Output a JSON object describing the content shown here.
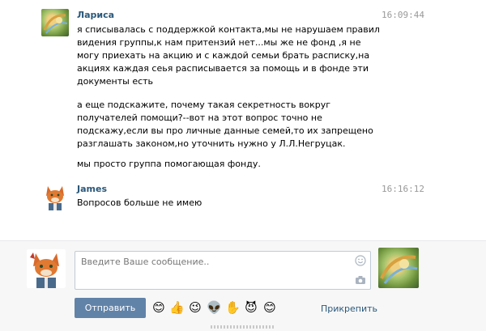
{
  "messages": [
    {
      "author": "Лариса",
      "time": "16:09:44",
      "paragraphs": [
        "я списывалась с поддержкой контакта,мы не нарушаем правил видения группы,к нам притензий нет...мы же не фонд ,я не могу приехать на акцию и с каждой семьи брать расписку,на акциях каждая сеья расписывается за помощь и в фонде эти документы есть",
        "а еще подскажите, почему такая секретность вокруг получателей помощи?--вот на этот вопрос точно не подскажу,если вы про личные данные семей,то их запрещено разглашать законом,но уточнить нужно у Л.Л.Негруцак.",
        "мы просто группа помогающая фонду."
      ]
    },
    {
      "author": "James",
      "time": "16:16:12",
      "paragraphs": [
        "Вопросов больше не имею"
      ]
    }
  ],
  "composer": {
    "placeholder": "Введите Ваше сообщение..",
    "send_label": "Отправить",
    "attach_label": "Прикрепить",
    "emojis": [
      "😊",
      "👍",
      "😉",
      "👽",
      "✋",
      "😈",
      "😊"
    ],
    "icons": [
      "smile-icon",
      "camera-icon"
    ]
  },
  "colors": {
    "author": "#2b587a",
    "send_button": "#6283a8",
    "time": "#999999"
  }
}
